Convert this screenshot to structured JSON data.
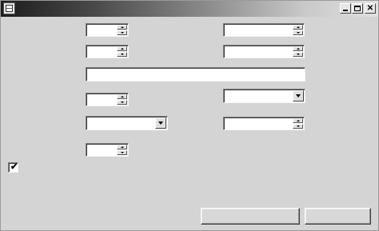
{
  "window": {
    "title": "",
    "controls": {
      "minimize": "",
      "maximize": "",
      "close": "✕"
    }
  },
  "form": {
    "left_spinners": [
      {
        "value": ""
      },
      {
        "value": ""
      },
      {
        "value": ""
      },
      {
        "value": ""
      }
    ],
    "right_spinners": [
      {
        "value": ""
      },
      {
        "value": ""
      },
      {
        "value": ""
      }
    ],
    "wide_text": {
      "value": ""
    },
    "combo_right": {
      "value": ""
    },
    "combo_left": {
      "value": ""
    },
    "checkbox": {
      "checked": true,
      "mark": "✔"
    },
    "buttons": {
      "primary_label": "",
      "secondary_label": ""
    }
  }
}
